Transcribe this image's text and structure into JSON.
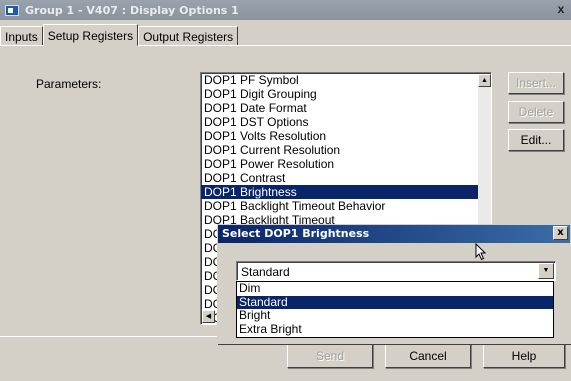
{
  "window": {
    "title": "Group 1 - V407 : Display Options 1",
    "close_label": "x"
  },
  "tabs": [
    {
      "label": "Inputs"
    },
    {
      "label": "Setup Registers"
    },
    {
      "label": "Output Registers"
    }
  ],
  "parameters_label": "Parameters:",
  "parameters": [
    "DOP1 PF Symbol",
    "DOP1 Digit Grouping",
    "DOP1 Date Format",
    "DOP1 DST Options",
    "DOP1 Volts Resolution",
    "DOP1 Current Resolution",
    "DOP1 Power Resolution",
    "DOP1 Contrast",
    "DOP1 Brightness",
    "DOP1 Backlight Timeout Behavior",
    "DOP1 Backlight Timeout",
    "DC",
    "DC",
    "DC",
    "DC",
    "DC",
    "DC",
    "DC"
  ],
  "selected_parameter": "DOP1 Brightness",
  "side_buttons": {
    "insert": "Insert...",
    "delete": "Delete",
    "edit": "Edit..."
  },
  "bottom_buttons": {
    "send": "Send",
    "cancel": "Cancel",
    "help": "Help"
  },
  "popup": {
    "title": "Select DOP1 Brightness",
    "close_label": "x",
    "current_value": "Standard",
    "options": [
      "Dim",
      "Standard",
      "Bright",
      "Extra Bright"
    ],
    "selected_option": "Standard"
  },
  "colors": {
    "selection": "#0a246a",
    "face": "#d4d0c8"
  }
}
